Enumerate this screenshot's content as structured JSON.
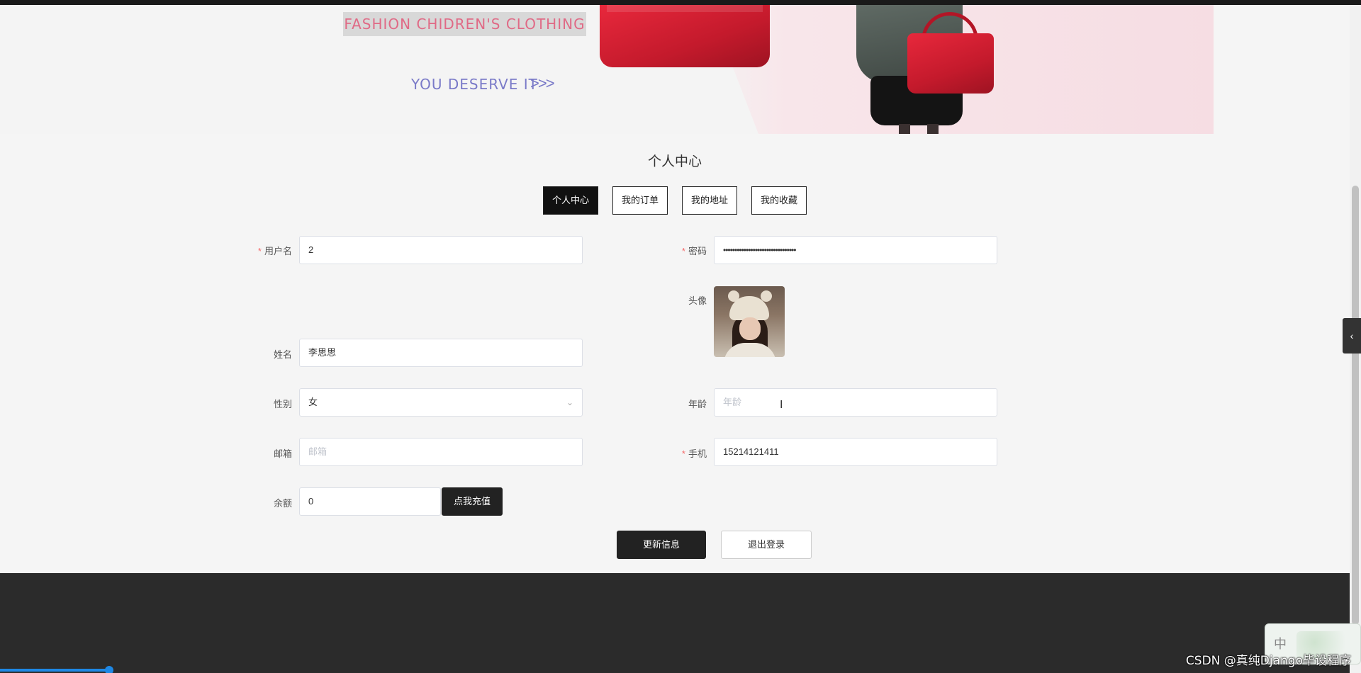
{
  "banner": {
    "tag_text": "FASHION CHIDREN'S CLOTHING",
    "slogan": "YOU DESERVE IT",
    "arrows": ">>>"
  },
  "page": {
    "title": "个人中心"
  },
  "tabs": [
    {
      "label": "个人中心",
      "active": true
    },
    {
      "label": "我的订单",
      "active": false
    },
    {
      "label": "我的地址",
      "active": false
    },
    {
      "label": "我的收藏",
      "active": false
    }
  ],
  "form": {
    "username": {
      "label": "用户名",
      "required": "*",
      "value": "2"
    },
    "password": {
      "label": "密码",
      "required": "*",
      "value": "••••••••••••••••••••••••••••••••"
    },
    "avatar": {
      "label": "头像"
    },
    "name": {
      "label": "姓名",
      "value": "李思思"
    },
    "gender": {
      "label": "性别",
      "value": "女",
      "arrow": "⌄"
    },
    "age": {
      "label": "年龄",
      "placeholder": "年龄"
    },
    "email": {
      "label": "邮箱",
      "placeholder": "邮箱"
    },
    "phone": {
      "label": "手机",
      "required": "*",
      "value": "15214121411"
    },
    "balance": {
      "label": "余额",
      "value": "0",
      "recharge_label": "点我充值"
    }
  },
  "actions": {
    "update_label": "更新信息",
    "logout_label": "退出登录"
  },
  "side_tab": {
    "icon": "‹"
  },
  "ime": {
    "char": "中"
  },
  "watermark": "CSDN @真纯Django毕设程序",
  "colors": {
    "accent_dark": "#222222",
    "required": "#f56c6c",
    "footer": "#2b2b2b",
    "bag_red": "#d41f33"
  }
}
